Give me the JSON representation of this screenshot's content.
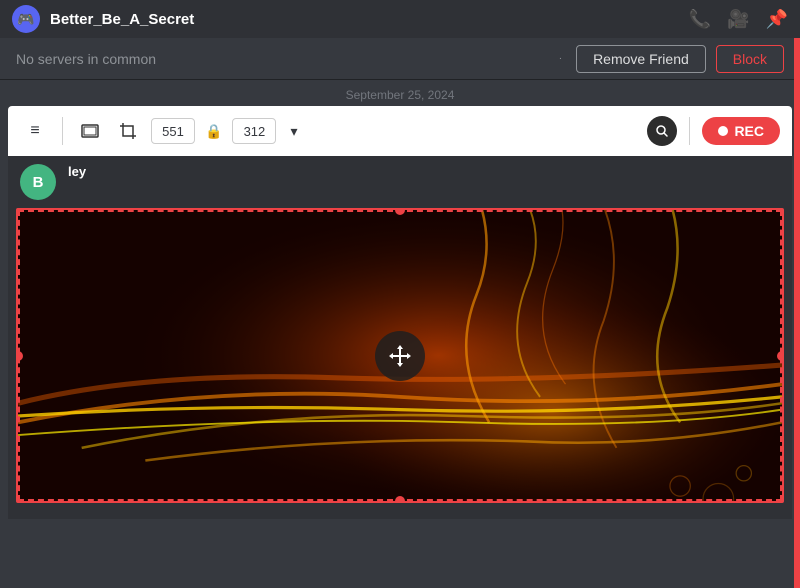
{
  "titleBar": {
    "username": "Better_Be_A_Secret",
    "logo": "🎮"
  },
  "actionBar": {
    "noServers": "No servers in common",
    "separator": "·",
    "removeFriendLabel": "Remove Friend",
    "blockLabel": "Block"
  },
  "dateSeparator": {
    "date": "September 25, 2024"
  },
  "toolbar": {
    "width": "551",
    "height": "312",
    "recLabel": "REC",
    "searchIcon": "search",
    "dropdownIcon": "▾"
  },
  "chat": {
    "avatarInitial": "B",
    "username": "ley"
  }
}
